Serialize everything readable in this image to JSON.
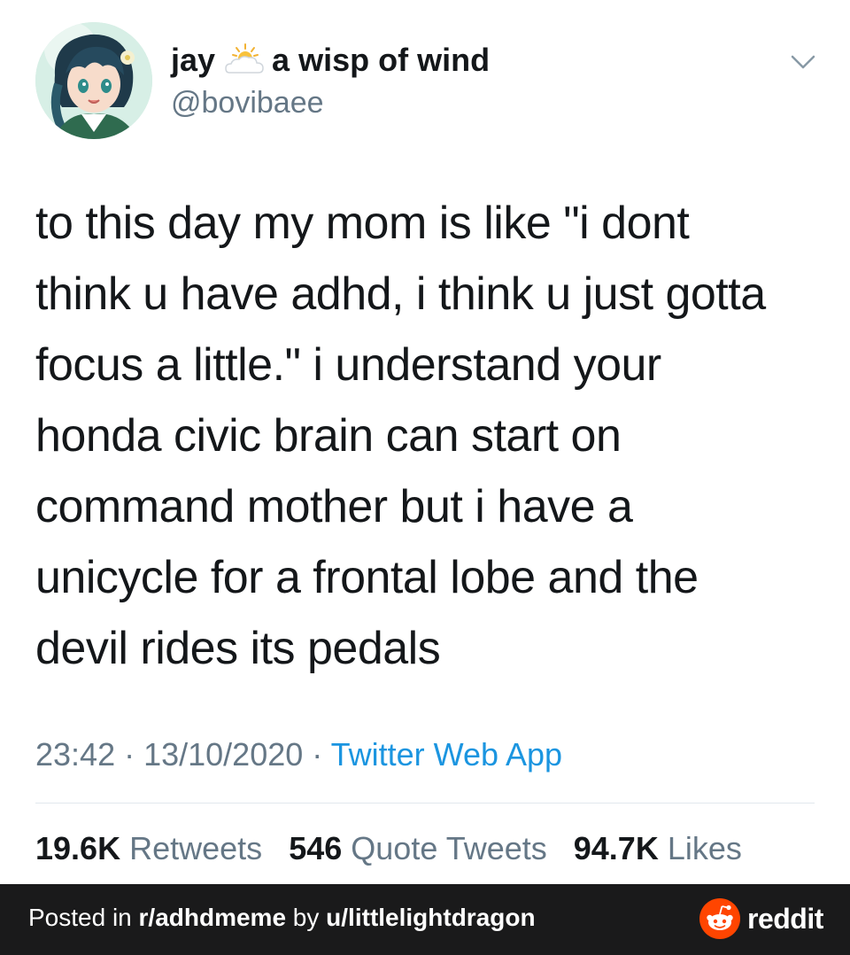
{
  "tweet": {
    "display_name_1": "jay",
    "display_name_emoji": "sun-behind-cloud-icon",
    "display_name_2": "a wisp of wind",
    "handle": "@bovibaee",
    "text": "to this day my mom is like \"i dont\nthink u have adhd, i think u just gotta\nfocus a little.\" i understand your\nhonda civic brain can start on\ncommand mother but i have a\nunicycle for a frontal lobe and the\ndevil rides its pedals",
    "time": "23:42",
    "date": "13/10/2020",
    "separator": " · ",
    "source": "Twitter Web App",
    "stats": {
      "retweets_count": "19.6K",
      "retweets_label": "Retweets",
      "quotes_count": "546",
      "quotes_label": "Quote Tweets",
      "likes_count": "94.7K",
      "likes_label": "Likes"
    }
  },
  "footer": {
    "posted_in": "Posted in ",
    "subreddit": "r/adhdmeme",
    "by": " by ",
    "user": "u/littlelightdragon",
    "brand": "reddit"
  },
  "colors": {
    "text_primary": "#14171a",
    "text_secondary": "#657786",
    "link": "#1b95e0",
    "footer_bg": "#1a1a1b",
    "reddit_orange": "#ff4500"
  }
}
